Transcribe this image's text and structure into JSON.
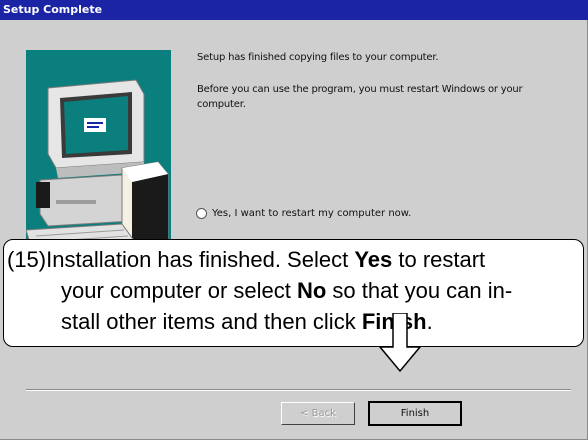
{
  "dialog": {
    "title": "Setup Complete",
    "message_line1": "Setup has finished copying files to your computer.",
    "message_line2": "Before you can use the program, you must restart Windows or your computer.",
    "radio_yes_label": "Yes, I want to restart my computer now."
  },
  "callout": {
    "line1_prefix": "(15)Installation has finished. Select ",
    "line1_bold": "Yes",
    "line1_suffix": " to restart",
    "line2_prefix": "your computer or select ",
    "line2_bold": "No",
    "line2_suffix": " so that you can in-",
    "line3_prefix": "stall other items and then click ",
    "line3_bold": "Finish",
    "line3_suffix": "."
  },
  "buttons": {
    "back_label": "< Back",
    "finish_label": "Finish"
  },
  "colors": {
    "titlebar": "#1c24a6",
    "art_panel": "#0b7e7e",
    "dialog_bg": "#cfcfcf"
  }
}
